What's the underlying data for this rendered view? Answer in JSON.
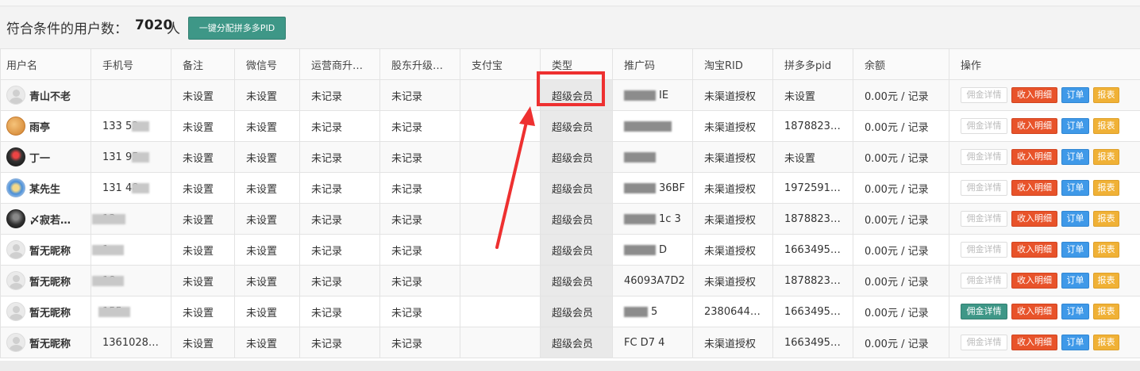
{
  "summary": {
    "label": "符合条件的用户数：",
    "count": "7020",
    "unit": "人",
    "assign_button": "一键分配拼多多PID"
  },
  "table": {
    "headers": [
      "用户名",
      "手机号",
      "备注",
      "微信号",
      "运营商升…",
      "股东升级…",
      "支付宝",
      "类型",
      "推广码",
      "淘宝RID",
      "拼多多pid",
      "余额",
      "操作"
    ],
    "rows": [
      {
        "name": "青山不老",
        "avatar": "default",
        "phone": "",
        "note": "未设置",
        "wechat": "未设置",
        "op_upgrade": "未记录",
        "sh_upgrade": "未记录",
        "alipay": "",
        "type": "超级会员",
        "promo": "IE",
        "taobao_rid": "未渠道授权",
        "pdd_pid": "未设置",
        "balance": "0.00元 / 记录",
        "detail_active": false
      },
      {
        "name": "雨亭",
        "avatar": "orange",
        "phone": "133 52…",
        "note": "未设置",
        "wechat": "未设置",
        "op_upgrade": "未记录",
        "sh_upgrade": "未记录",
        "alipay": "",
        "type": "超级会员",
        "promo": "",
        "taobao_rid": "未渠道授权",
        "pdd_pid": "1878823…",
        "balance": "0.00元 / 记录",
        "detail_active": false
      },
      {
        "name": "丁一",
        "avatar": "dark",
        "phone": "131 95…",
        "note": "未设置",
        "wechat": "未设置",
        "op_upgrade": "未记录",
        "sh_upgrade": "未记录",
        "alipay": "",
        "type": "超级会员",
        "promo": "",
        "taobao_rid": "未渠道授权",
        "pdd_pid": "未设置",
        "balance": "0.00元 / 记录",
        "detail_active": false
      },
      {
        "name": "某先生",
        "avatar": "blue",
        "phone": "131 48…",
        "note": "未设置",
        "wechat": "未设置",
        "op_upgrade": "未记录",
        "sh_upgrade": "未记录",
        "alipay": "",
        "type": "超级会员",
        "promo": "36BF",
        "taobao_rid": "未渠道授权",
        "pdd_pid": "1972591…",
        "balance": "0.00元 / 记录",
        "detail_active": false
      },
      {
        "name": "〆寂若…",
        "avatar": "black",
        "phone": "13",
        "note": "未设置",
        "wechat": "未设置",
        "op_upgrade": "未记录",
        "sh_upgrade": "未记录",
        "alipay": "",
        "type": "超级会员",
        "promo": "1c 3",
        "taobao_rid": "未渠道授权",
        "pdd_pid": "1878823…",
        "balance": "0.00元 / 记录",
        "detail_active": false
      },
      {
        "name": "暂无昵称",
        "avatar": "default",
        "phone": "1 .",
        "note": "未设置",
        "wechat": "未设置",
        "op_upgrade": "未记录",
        "sh_upgrade": "未记录",
        "alipay": "",
        "type": "超级会员",
        "promo": "D",
        "taobao_rid": "未渠道授权",
        "pdd_pid": "1663495…",
        "balance": "0.00元 / 记录",
        "detail_active": false
      },
      {
        "name": "暂无昵称",
        "avatar": "default",
        "phone": "18",
        "note": "未设置",
        "wechat": "未设置",
        "op_upgrade": "未记录",
        "sh_upgrade": "未记录",
        "alipay": "",
        "type": "超级会员",
        "promo": "46093A7D2",
        "taobao_rid": "未渠道授权",
        "pdd_pid": "1878823…",
        "balance": "0.00元 / 记录",
        "detail_active": false
      },
      {
        "name": "暂无昵称",
        "avatar": "default",
        "phone": "155",
        "note": "未设置",
        "wechat": "未设置",
        "op_upgrade": "未记录",
        "sh_upgrade": "未记录",
        "alipay": "",
        "type": "超级会员",
        "promo": "5",
        "taobao_rid": "2380644…",
        "pdd_pid": "1663495…",
        "balance": "0.00元 / 记录",
        "detail_active": true
      },
      {
        "name": "暂无昵称",
        "avatar": "default",
        "phone": "1361028…",
        "note": "未设置",
        "wechat": "未设置",
        "op_upgrade": "未记录",
        "sh_upgrade": "未记录",
        "alipay": "",
        "type": "超级会员",
        "promo": "FC D7 4",
        "taobao_rid": "未渠道授权",
        "pdd_pid": "1663495…",
        "balance": "0.00元 / 记录",
        "detail_active": false
      }
    ],
    "actions": {
      "detail": "佣金详情",
      "income": "收入明细",
      "order": "订单",
      "report": "报表"
    }
  },
  "colors": {
    "accent": "#3e9787",
    "highlight": "#ee3030",
    "income": "#e8532a",
    "order": "#3f99e8",
    "report": "#f0b136"
  }
}
